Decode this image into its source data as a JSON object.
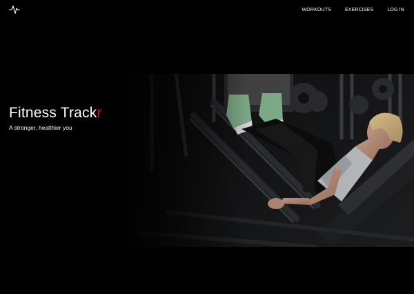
{
  "nav": {
    "brand_icon": "pulse-icon",
    "links": [
      "WORKOUTS",
      "EXERCISES",
      "LOG IN"
    ]
  },
  "hero": {
    "title_main": "Fitness Track",
    "title_accent": "r",
    "subtitle": "A stronger, healthier you",
    "accent_color": "#c8101d",
    "image_description": "woman-on-leg-press-machine-photo"
  }
}
